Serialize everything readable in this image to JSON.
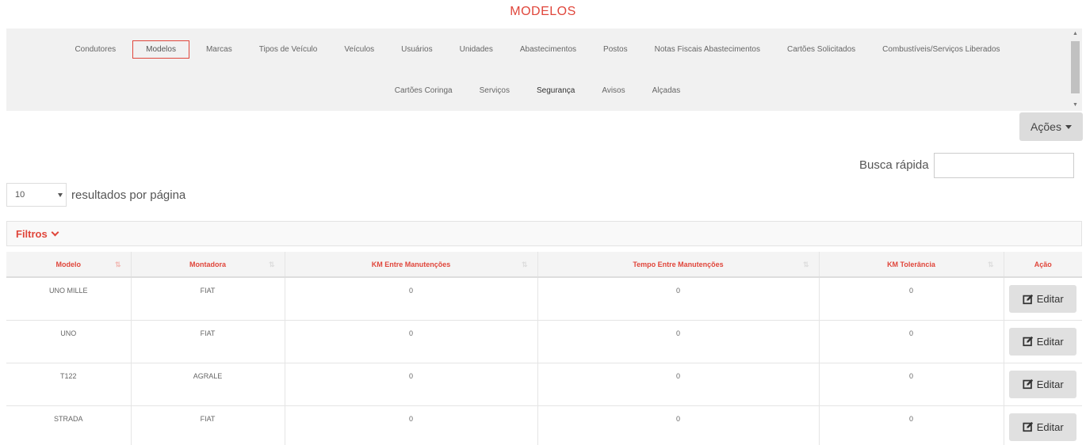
{
  "page_title": "MODELOS",
  "nav": {
    "row1": [
      "Condutores",
      "Modelos",
      "Marcas",
      "Tipos de Veículo",
      "Veículos",
      "Usuários",
      "Unidades",
      "Abastecimentos",
      "Postos",
      "Notas Fiscais Abastecimentos",
      "Cartões Solicitados",
      "Combustíveis/Serviços Liberados"
    ],
    "row2": [
      "Cartões Coringa",
      "Serviços",
      "Segurança",
      "Avisos",
      "Alçadas"
    ],
    "active": "Modelos"
  },
  "actions_label": "Ações",
  "per_page": {
    "value": "10",
    "label": "resultados por página"
  },
  "search": {
    "label": "Busca rápida",
    "value": ""
  },
  "filters_label": "Filtros",
  "table": {
    "headers": [
      "Modelo",
      "Montadora",
      "KM Entre Manutenções",
      "Tempo Entre Manutenções",
      "KM Tolerância",
      "Ação"
    ],
    "rows": [
      [
        "UNO MILLE",
        "FIAT",
        "0",
        "0",
        "0"
      ],
      [
        "UNO",
        "FIAT",
        "0",
        "0",
        "0"
      ],
      [
        "T122",
        "AGRALE",
        "0",
        "0",
        "0"
      ],
      [
        "STRADA",
        "FIAT",
        "0",
        "0",
        "0"
      ]
    ],
    "edit_label": "Editar"
  },
  "colors": {
    "accent": "#e0463b",
    "panel": "#f1f1f1",
    "button": "#e0e0e0"
  },
  "icons": {
    "edit": "edit-icon",
    "caret": "caret-down-icon",
    "filters": "chevron-down-icon",
    "sort": "sort-icon"
  }
}
